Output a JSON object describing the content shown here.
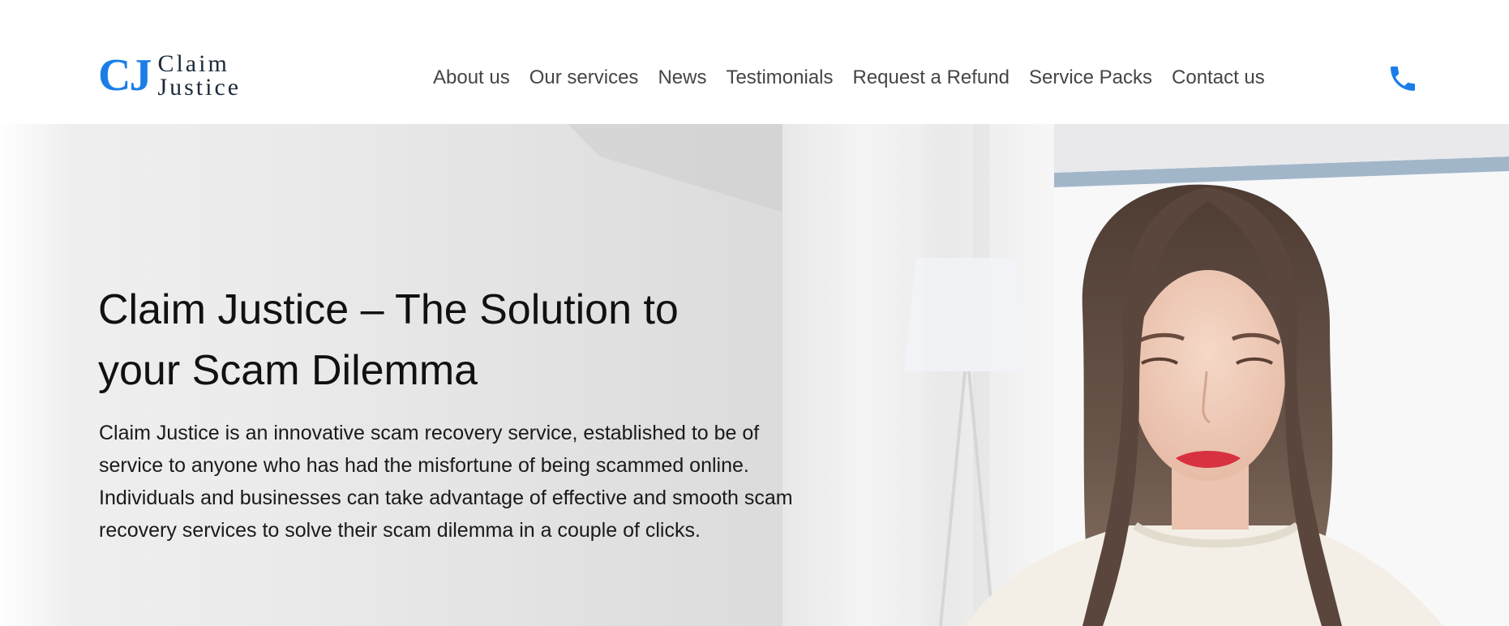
{
  "header": {
    "logo": {
      "mark": "CJ",
      "word1": "Claim",
      "word2": "Justice"
    },
    "nav": [
      {
        "label": "About us"
      },
      {
        "label": "Our services"
      },
      {
        "label": "News"
      },
      {
        "label": "Testimonials"
      },
      {
        "label": "Request a Refund"
      },
      {
        "label": "Service Packs"
      },
      {
        "label": "Contact us"
      }
    ],
    "phone_icon": "phone-icon"
  },
  "hero": {
    "title": "Claim Justice – The Solution to your Scam Dilemma",
    "text": "Claim Justice is an innovative scam recovery service, established to be of service to anyone who has had the misfortune of being scammed online. Individuals and businesses can take advantage of effective and smooth scam recovery services to solve their scam dilemma in a couple of clicks."
  },
  "colors": {
    "brand": "#1a7ee8",
    "nav_text": "#454545",
    "heading": "#111111"
  }
}
